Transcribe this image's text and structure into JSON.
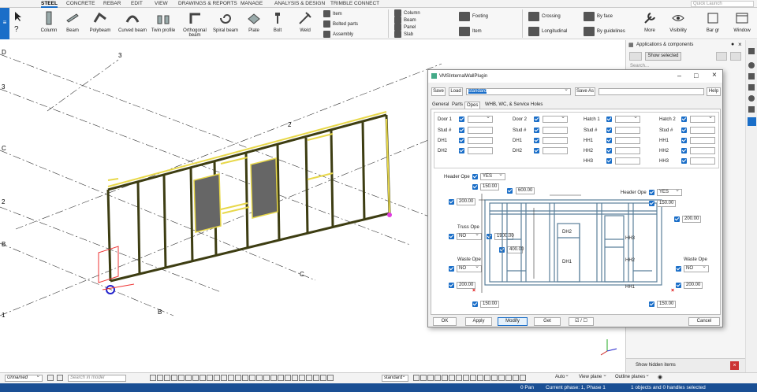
{
  "ribbon": {
    "tabs": [
      "STEEL",
      "CONCRETE",
      "REBAR",
      "EDIT",
      "VIEW",
      "DRAWINGS & REPORTS",
      "MANAGE",
      "ANALYSIS & DESIGN",
      "TRIMBLE CONNECT"
    ],
    "active_tab": "STEEL",
    "quick_launch_placeholder": "Quick Launch",
    "buttons": [
      "Column",
      "Beam",
      "Polybeam",
      "Curved beam",
      "Twin profile",
      "Orthogonal beam",
      "Spiral beam",
      "Plate",
      "Bolt",
      "Weld"
    ],
    "item_group": [
      "Item",
      "Bolted parts",
      "Assembly"
    ],
    "concrete_group": [
      "Column",
      "Beam",
      "Panel",
      "Slab"
    ],
    "footing_group": [
      "Footing",
      "Item"
    ],
    "rebar_group": [
      "Crossing",
      "Longitudinal"
    ],
    "face_group": [
      "By face",
      "By guidelines"
    ],
    "right_buttons": [
      "More",
      "Visibility",
      "Bar gr",
      "Window"
    ]
  },
  "viewport": {
    "grid_labels": [
      "D",
      "3",
      "3",
      "C",
      "2",
      "2",
      "B",
      "1",
      "C",
      "B"
    ]
  },
  "right_panel": {
    "title": "Applications & components",
    "show_selected": "Show selected",
    "search_placeholder": "Search...",
    "show_hidden": "Show hidden items"
  },
  "dialog": {
    "title": "VMSInternalWallPlugin",
    "save": "Save",
    "load": "Load",
    "preset": "standard",
    "save_as": "Save As",
    "help": "Help",
    "tabs": [
      "General",
      "Parts",
      "Opes",
      "WHB, WC, & Service Holes"
    ],
    "active_tab": "Opes",
    "grid": [
      {
        "col": "Door 1",
        "rows": [
          "Door 1",
          "Stud #",
          "DH1",
          "DH2"
        ]
      },
      {
        "col": "Door 2",
        "rows": [
          "Door 2",
          "Stud #",
          "DH1",
          "DH2"
        ]
      },
      {
        "col": "Hatch 1",
        "rows": [
          "Hatch 1",
          "Stud #",
          "HH1",
          "HH2",
          "HH3"
        ]
      },
      {
        "col": "Hatch 2",
        "rows": [
          "Hatch 2",
          "Stud #",
          "HH1",
          "HH2",
          "HH3"
        ]
      }
    ],
    "header_ope_label": "Header Ope",
    "header_ope_value": "YES",
    "header_ope_right_label": "Header Ope",
    "header_ope_right_value": "YES",
    "truss_ope_label": "Truss Ope",
    "truss_ope_value": "NO",
    "waste_ope_label": "Waste Ope",
    "waste_ope_value": "NO",
    "waste_ope_right_label": "Waste Ope",
    "waste_ope_right_value": "NO",
    "values": {
      "v150_top": "150.00",
      "v600": "600.00",
      "v200_left": "200.00",
      "v1900": "1900.00",
      "v400": "400.00",
      "v200_bottom_left": "200.00",
      "v150_bottom": "150.00",
      "v150_right_top": "150.00",
      "v200_right": "200.00",
      "v200_bottom_right": "200.00",
      "v150_bottom_right": "150.00"
    },
    "diagram_labels": [
      "DH2",
      "DH1",
      "HH3",
      "HH2",
      "HH1"
    ],
    "buttons": {
      "ok": "OK",
      "apply": "Apply",
      "modify": "Modify",
      "get": "Get",
      "toggle": "☑ / ☐",
      "cancel": "Cancel"
    }
  },
  "bottom_toolbar": {
    "view_select": "Unnamed",
    "search_placeholder": "Search in model",
    "standard": "standard",
    "auto": "Auto",
    "view_plane": "View plane",
    "outline_planes": "Outline planes"
  },
  "status_bar": {
    "pan": "0 Pan",
    "phase": "Current phase: 1, Phase 1",
    "selection": "1 objects and 0 handles selected"
  },
  "colors": {
    "accent": "#1a6ec8",
    "status": "#1a4f94",
    "frame": "#3d3d12",
    "frame_yellow": "#e8d84a"
  }
}
